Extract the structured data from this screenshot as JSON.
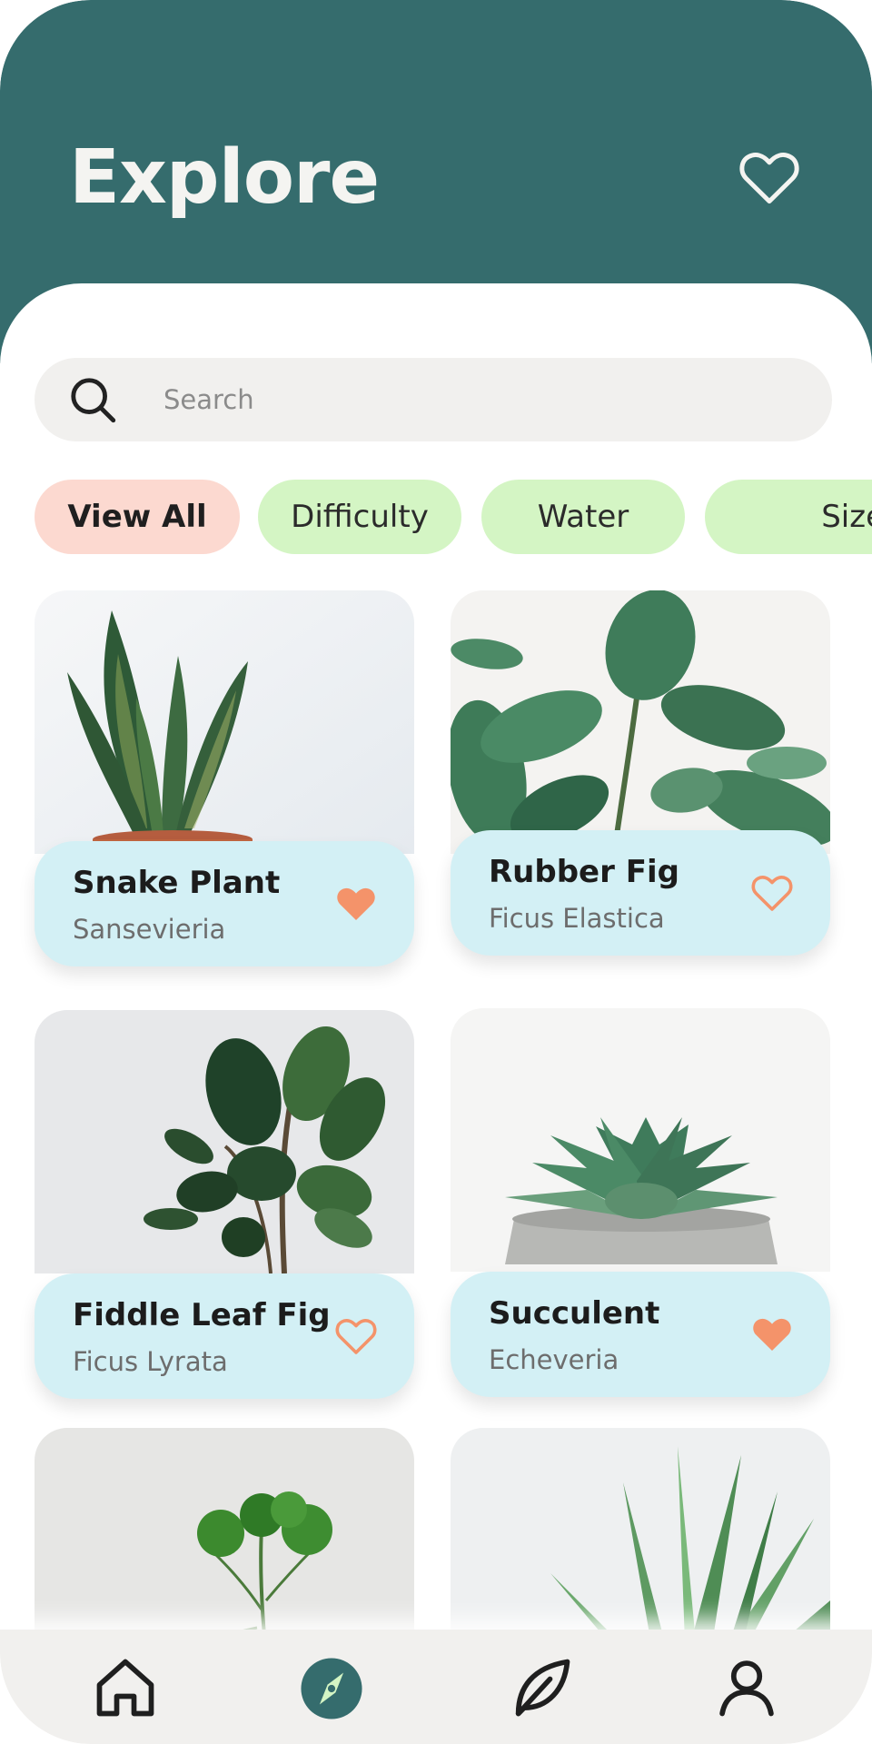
{
  "header": {
    "title": "Explore",
    "favorites_icon": "heart-outline-icon"
  },
  "search": {
    "placeholder": "Search",
    "icon": "search-icon"
  },
  "filters": [
    {
      "label": "View All",
      "active": true
    },
    {
      "label": "Difficulty",
      "active": false
    },
    {
      "label": "Water",
      "active": false
    },
    {
      "label": "Size",
      "active": false
    }
  ],
  "plants": [
    {
      "name": "Snake Plant",
      "scientific": "Sansevieria",
      "favorite": true
    },
    {
      "name": "Rubber Fig",
      "scientific": "Ficus Elastica",
      "favorite": false
    },
    {
      "name": "Fiddle Leaf Fig",
      "scientific": "Ficus Lyrata",
      "favorite": false
    },
    {
      "name": "Succulent",
      "scientific": "Echeveria",
      "favorite": true
    },
    {
      "name": "",
      "scientific": "",
      "favorite": null
    },
    {
      "name": "",
      "scientific": "",
      "favorite": null
    }
  ],
  "nav": [
    {
      "icon": "home-icon",
      "active": false
    },
    {
      "icon": "compass-icon",
      "active": true
    },
    {
      "icon": "leaf-icon",
      "active": false
    },
    {
      "icon": "profile-icon",
      "active": false
    }
  ],
  "colors": {
    "header": "#356c6d",
    "heart": "#f4936a",
    "card_info": "#d3f0f5",
    "chip": "#d4f5c4",
    "chip_active": "#fcd9d0"
  }
}
